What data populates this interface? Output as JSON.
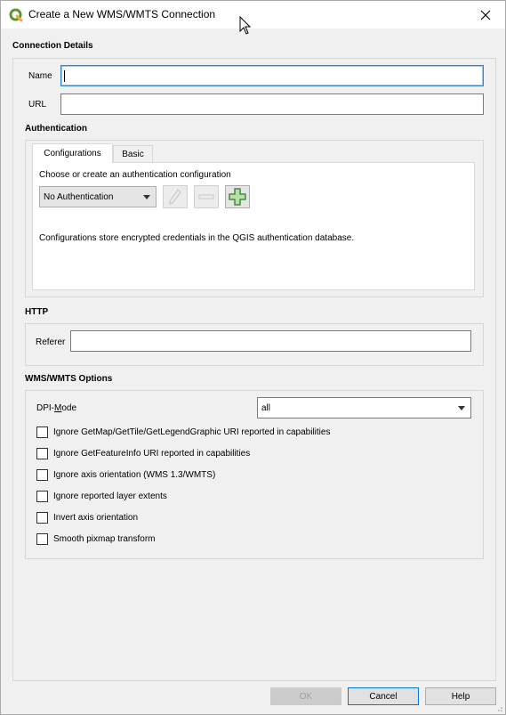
{
  "window": {
    "title": "Create a New WMS/WMTS Connection"
  },
  "connection_details": {
    "heading": "Connection Details",
    "name_label": "Name",
    "name_value": "",
    "url_label": "URL",
    "url_value": ""
  },
  "authentication": {
    "heading": "Authentication",
    "tabs": [
      {
        "label": "Configurations",
        "active": true
      },
      {
        "label": "Basic",
        "active": false
      }
    ],
    "choose_text": "Choose or create an authentication configuration",
    "selected_config": "No Authentication",
    "info_text": "Configurations store encrypted credentials in the QGIS authentication database."
  },
  "http": {
    "heading": "HTTP",
    "referer_label": "Referer",
    "referer_value": ""
  },
  "wms_options": {
    "heading": "WMS/WMTS Options",
    "dpi_label_pre": "DPI-",
    "dpi_label_underlined": "M",
    "dpi_label_post": "ode",
    "dpi_value": "all",
    "checkboxes": [
      {
        "label": "Ignore GetMap/GetTile/GetLegendGraphic URI reported in capabilities",
        "checked": false
      },
      {
        "label": "Ignore GetFeatureInfo URI reported in capabilities",
        "checked": false
      },
      {
        "label": "Ignore axis orientation (WMS 1.3/WMTS)",
        "checked": false
      },
      {
        "label": "Ignore reported layer extents",
        "checked": false
      },
      {
        "label": "Invert axis orientation",
        "checked": false
      },
      {
        "label": "Smooth pixmap transform",
        "checked": false
      }
    ]
  },
  "buttons": {
    "ok": "OK",
    "cancel": "Cancel",
    "help": "Help"
  },
  "colors": {
    "accent": "#3c82c8",
    "qgis_green": "#589632",
    "add_green": "#3a8a3a"
  }
}
